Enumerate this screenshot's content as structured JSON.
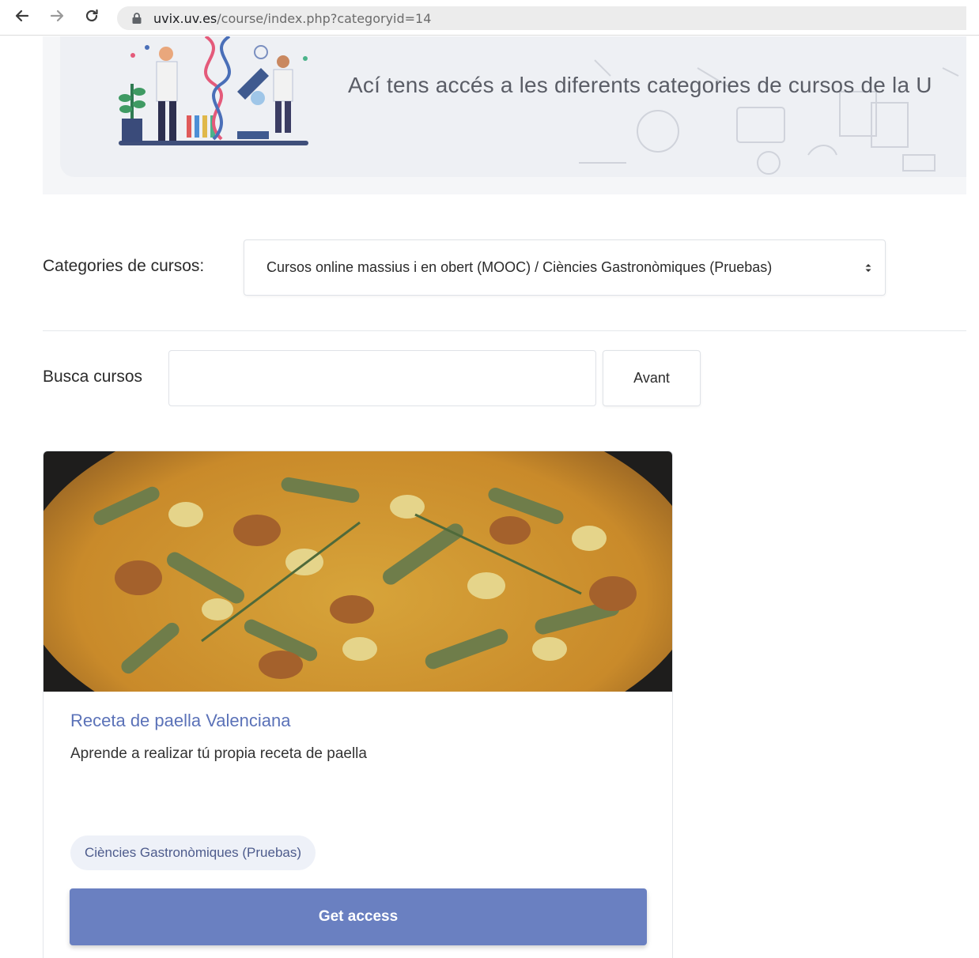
{
  "browser": {
    "url_host": "uvix.uv.es",
    "url_path": "/course/index.php?categoryid=14"
  },
  "hero": {
    "text": "Ací tens accés a les diferents categories de cursos de la U"
  },
  "categories": {
    "label": "Categories de cursos:",
    "selected": "Cursos online massius i en obert (MOOC) / Ciències Gastronòmiques (Pruebas)"
  },
  "search": {
    "label": "Busca cursos",
    "value": "",
    "button_label": "Avant"
  },
  "course": {
    "title": "Receta de paella Valenciana",
    "summary": "Aprende a realizar tú propia receta de paella",
    "category_badge": "Ciències Gastronòmiques (Pruebas)",
    "action_label": "Get access"
  },
  "colors": {
    "accent": "#6a80c1",
    "link": "#5b72b8",
    "badge_bg": "#eef1f8"
  }
}
